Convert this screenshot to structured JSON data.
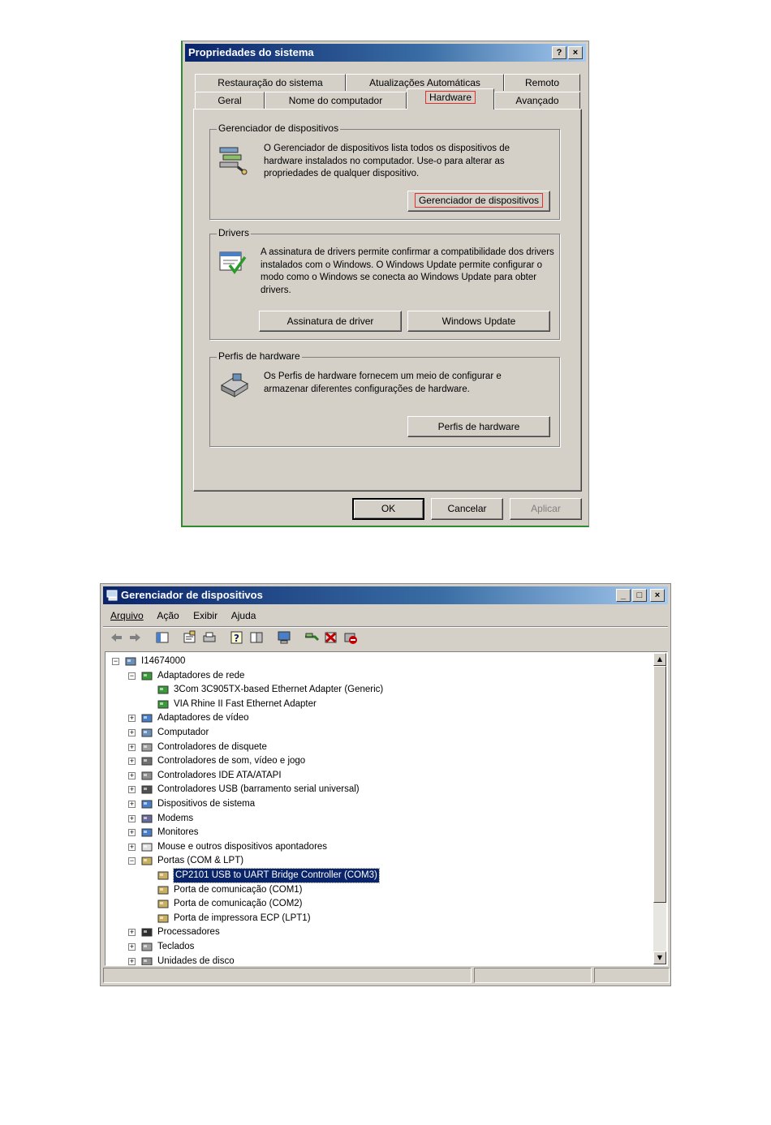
{
  "sys_props": {
    "title": "Propriedades do sistema",
    "help_btn": "?",
    "close_btn": "×",
    "tabs_row1": [
      "Restauração do sistema",
      "Atualizações Automáticas",
      "Remoto"
    ],
    "tabs_row2": [
      "Geral",
      "Nome do computador",
      "Hardware",
      "Avançado"
    ],
    "active_tab": "Hardware",
    "groups": {
      "device_manager": {
        "label": "Gerenciador de dispositivos",
        "text": "O Gerenciador de dispositivos lista todos os dispositivos de hardware instalados no computador. Use-o para alterar as propriedades de qualquer dispositivo.",
        "button": "Gerenciador de dispositivos"
      },
      "drivers": {
        "label": "Drivers",
        "text": "A assinatura de drivers permite confirmar a compatibilidade dos drivers instalados com o Windows. O Windows Update permite configurar o modo como o Windows se conecta ao Windows Update para obter drivers.",
        "button1": "Assinatura de driver",
        "button2": "Windows Update"
      },
      "profiles": {
        "label": "Perfis de hardware",
        "text": "Os Perfis de hardware fornecem um meio de configurar e armazenar diferentes configurações de hardware.",
        "button": "Perfis de hardware"
      }
    },
    "ok": "OK",
    "cancel": "Cancelar",
    "apply": "Aplicar"
  },
  "dev_mgr": {
    "title": "Gerenciador de dispositivos",
    "menu": [
      "Arquivo",
      "Ação",
      "Exibir",
      "Ajuda"
    ],
    "tree": [
      {
        "label": "I14674000",
        "level": 0,
        "expander": "−",
        "icon": "computer-icon"
      },
      {
        "label": "Adaptadores de rede",
        "level": 1,
        "expander": "−",
        "icon": "network-card-icon"
      },
      {
        "label": "3Com 3C905TX-based Ethernet Adapter (Generic)",
        "level": 2,
        "expander": "",
        "icon": "network-card-icon"
      },
      {
        "label": "VIA Rhine II Fast Ethernet Adapter",
        "level": 2,
        "expander": "",
        "icon": "network-card-icon"
      },
      {
        "label": "Adaptadores de vídeo",
        "level": 1,
        "expander": "+",
        "icon": "display-icon"
      },
      {
        "label": "Computador",
        "level": 1,
        "expander": "+",
        "icon": "computer-icon"
      },
      {
        "label": "Controladores de disquete",
        "level": 1,
        "expander": "+",
        "icon": "floppy-icon"
      },
      {
        "label": "Controladores de som, vídeo e jogo",
        "level": 1,
        "expander": "+",
        "icon": "sound-icon"
      },
      {
        "label": "Controladores IDE ATA/ATAPI",
        "level": 1,
        "expander": "+",
        "icon": "ide-icon"
      },
      {
        "label": "Controladores USB (barramento serial universal)",
        "level": 1,
        "expander": "+",
        "icon": "usb-icon"
      },
      {
        "label": "Dispositivos de sistema",
        "level": 1,
        "expander": "+",
        "icon": "system-icon"
      },
      {
        "label": "Modems",
        "level": 1,
        "expander": "+",
        "icon": "modem-icon"
      },
      {
        "label": "Monitores",
        "level": 1,
        "expander": "+",
        "icon": "monitor-icon"
      },
      {
        "label": "Mouse e outros dispositivos apontadores",
        "level": 1,
        "expander": "+",
        "icon": "mouse-icon"
      },
      {
        "label": "Portas (COM & LPT)",
        "level": 1,
        "expander": "−",
        "icon": "port-icon"
      },
      {
        "label": "CP2101 USB to UART Bridge Controller (COM3)",
        "level": 2,
        "expander": "",
        "icon": "port-icon",
        "selected": true
      },
      {
        "label": "Porta de comunicação (COM1)",
        "level": 2,
        "expander": "",
        "icon": "port-icon"
      },
      {
        "label": "Porta de comunicação (COM2)",
        "level": 2,
        "expander": "",
        "icon": "port-icon"
      },
      {
        "label": "Porta de impressora ECP (LPT1)",
        "level": 2,
        "expander": "",
        "icon": "port-icon"
      },
      {
        "label": "Processadores",
        "level": 1,
        "expander": "+",
        "icon": "cpu-icon"
      },
      {
        "label": "Teclados",
        "level": 1,
        "expander": "+",
        "icon": "keyboard-icon"
      },
      {
        "label": "Unidades de disco",
        "level": 1,
        "expander": "+",
        "icon": "disk-icon"
      }
    ]
  }
}
